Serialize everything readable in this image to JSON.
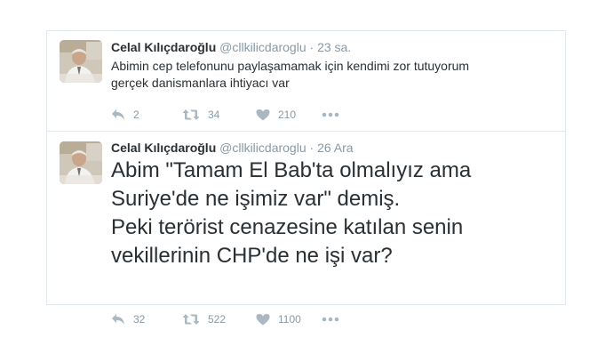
{
  "tweets": [
    {
      "fullname": "Celal Kılıçdaroğlu",
      "username": "@cllkilicdaroglu",
      "separator": "·",
      "time": "23 sa.",
      "lines": [
        "Abimin cep telefonunu  paylaşamamak için kendimi zor tutuyorum",
        "gerçek danismanlara ihtiyacı var"
      ],
      "replies": "2",
      "retweets": "34",
      "likes": "210",
      "icons": {
        "reply": "reply-icon",
        "retweet": "retweet-icon",
        "like": "heart-icon",
        "more": "more-icon"
      }
    },
    {
      "fullname": "Celal Kılıçdaroğlu",
      "username": "@cllkilicdaroglu",
      "separator": "·",
      "time": "26 Ara",
      "lines": [
        "Abim \"Tamam El Bab'ta olmalıyız ama",
        "Suriye'de ne işimiz var\" demiş.",
        "Peki terörist cenazesine katılan senin",
        "vekillerinin CHP'de ne işi var?"
      ],
      "replies": "32",
      "retweets": "522",
      "likes": "1100",
      "icons": {
        "reply": "reply-icon",
        "retweet": "retweet-icon",
        "like": "heart-icon",
        "more": "more-icon"
      }
    }
  ],
  "colors": {
    "text": "#292f33",
    "secondary": "#8899a6",
    "icon": "#aab8c2",
    "border": "#e1e8ed"
  }
}
